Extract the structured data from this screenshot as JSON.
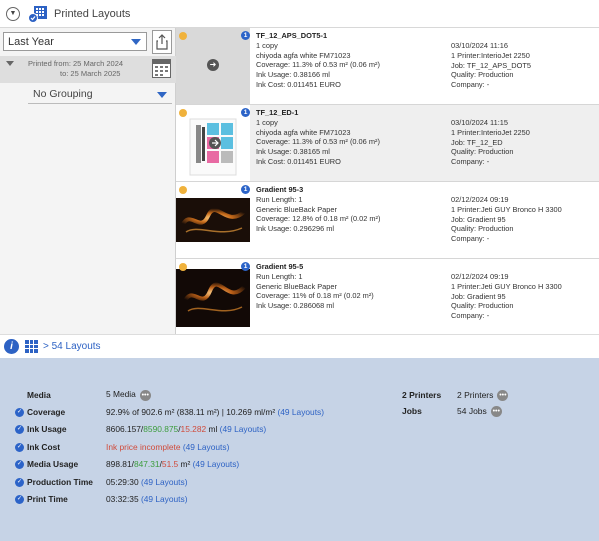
{
  "topbar": {
    "title": "Printed Layouts"
  },
  "left": {
    "period": "Last Year",
    "printed_from": "Printed from: 25 March 2024",
    "printed_to": "to: 25 March 2025",
    "grouping": "No Grouping"
  },
  "rows": [
    {
      "name": "TF_12_APS_DOT5-1",
      "l1": "1 copy",
      "l2": "chiyoda agfa white FM71023",
      "l3": "Coverage: 11.3% of 0.53 m² (0.06 m²)",
      "l4": "Ink Usage: 0.38166 ml",
      "l5": "Ink Cost: 0.011451 EURO",
      "date": "03/10/2024 11:16",
      "printer": "1 Printer:InterioJet 2250",
      "job": "Job: TF_12_APS_DOT5",
      "quality": "Quality: Production",
      "company": "Company: -",
      "badge": "1"
    },
    {
      "name": "TF_12_ED-1",
      "l1": "1 copy",
      "l2": "chiyoda agfa white FM71023",
      "l3": "Coverage: 11.3% of 0.53 m² (0.06 m²)",
      "l4": "Ink Usage: 0.38165 ml",
      "l5": "Ink Cost: 0.011451 EURO",
      "date": "03/10/2024 11:15",
      "printer": "1 Printer:InterioJet 2250",
      "job": "Job: TF_12_ED",
      "quality": "Quality: Production",
      "company": "Company: -",
      "badge": "1"
    },
    {
      "name": "Gradient 95-3",
      "l1": "Run Length: 1",
      "l2": "Generic BlueBack Paper",
      "l3": "Coverage: 12.8% of 0.18 m² (0.02 m²)",
      "l4": "Ink Usage: 0.296296 ml",
      "l5": "",
      "date": "02/12/2024 09:19",
      "printer": "1 Printer:Jeti GUY Bronco H 3300",
      "job": "Job: Gradient 95",
      "quality": "Quality: Production",
      "company": "Company: -",
      "badge": "1"
    },
    {
      "name": "Gradient 95-5",
      "l1": "Run Length: 1",
      "l2": "Generic BlueBack Paper",
      "l3": "Coverage: 11% of 0.18 m² (0.02 m²)",
      "l4": "Ink Usage: 0.286068 ml",
      "l5": "",
      "date": "02/12/2024 09:19",
      "printer": "1 Printer:Jeti GUY Bronco H 3300",
      "job": "Job: Gradient 95",
      "quality": "Quality: Production",
      "company": "Company: -",
      "badge": "1"
    }
  ],
  "bottombar": {
    "layouts_link": "> 54 Layouts"
  },
  "summary": {
    "media_label": "Media",
    "media_value": "5 Media",
    "coverage_label": "Coverage",
    "coverage_value": "92.9% of 902.6 m² (838.11 m²)  |  10.269 ml/m²",
    "coverage_link": "(49 Layouts)",
    "ink_usage_label": "Ink Usage",
    "ink_usage_main": "8606.157/",
    "ink_usage_green": "8590.875",
    "ink_usage_sep": "/",
    "ink_usage_red": "15.282",
    "ink_usage_unit": " ml",
    "ink_usage_link": "(49 Layouts)",
    "ink_cost_label": "Ink Cost",
    "ink_cost_value": "Ink price incomplete",
    "ink_cost_link": "(49 Layouts)",
    "media_usage_label": "Media Usage",
    "media_usage_main": "898.81/",
    "media_usage_green": "847.31",
    "media_usage_sep": "/",
    "media_usage_red": "51.5",
    "media_usage_unit": " m²",
    "media_usage_link": "(49 Layouts)",
    "production_time_label": "Production Time",
    "production_time_value": "05:29:30",
    "production_time_link": "(49 Layouts)",
    "print_time_label": "Print Time",
    "print_time_value": "03:32:35",
    "print_time_link": "(49 Layouts)",
    "printers_label": "2 Printers",
    "printers_value": "2 Printers",
    "jobs_label": "Jobs",
    "jobs_value": "54 Jobs"
  },
  "colors": {
    "accent": "#2d62c4",
    "summary_bg": "#c6d3e6",
    "green": "#3d9d3d",
    "red": "#d04b3b",
    "dot": "#f0b23c"
  }
}
